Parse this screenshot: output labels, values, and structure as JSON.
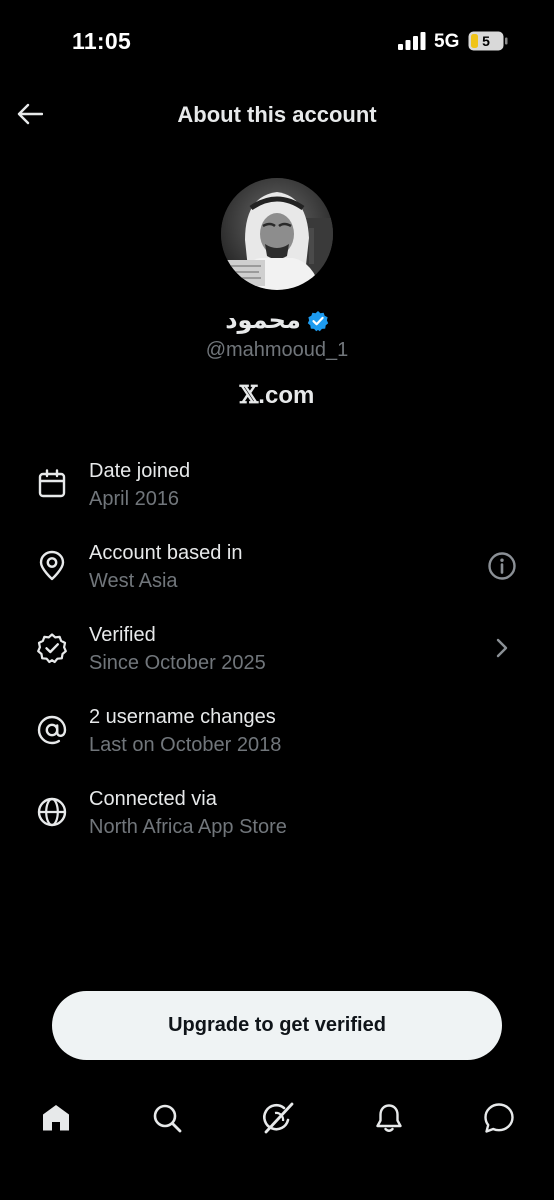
{
  "status_bar": {
    "time": "11:05",
    "network": "5G",
    "battery_level": "5"
  },
  "header": {
    "title": "About this account",
    "back_icon": "arrow-left-icon"
  },
  "profile": {
    "display_name": "محمود",
    "verified_icon": "verified-badge-icon",
    "handle": "@mahmooud_1",
    "site_mark": "𝕏",
    "site_suffix": ".com"
  },
  "info_rows": [
    {
      "icon": "calendar-icon",
      "title": "Date joined",
      "subtitle": "April 2016"
    },
    {
      "icon": "location-pin-icon",
      "title": "Account based in",
      "subtitle": "West Asia",
      "trailing_icon": "info-icon"
    },
    {
      "icon": "verified-seal-icon",
      "title": "Verified",
      "subtitle": "Since October 2025",
      "trailing_icon": "chevron-right-icon"
    },
    {
      "icon": "at-sign-icon",
      "title": "2 username changes",
      "subtitle": "Last on October 2018"
    },
    {
      "icon": "globe-icon",
      "title": "Connected via",
      "subtitle": "North Africa App Store"
    }
  ],
  "upgrade_button": {
    "label": "Upgrade to get verified"
  },
  "bottom_nav": [
    {
      "icon": "home-icon"
    },
    {
      "icon": "search-icon"
    },
    {
      "icon": "grok-icon"
    },
    {
      "icon": "bell-icon"
    },
    {
      "icon": "messages-icon"
    }
  ],
  "colors": {
    "background": "#000000",
    "primary_text": "#e7e9ea",
    "secondary_text": "#71767b",
    "verified_blue": "#1d9bf0",
    "button_bg": "#eff3f4"
  }
}
